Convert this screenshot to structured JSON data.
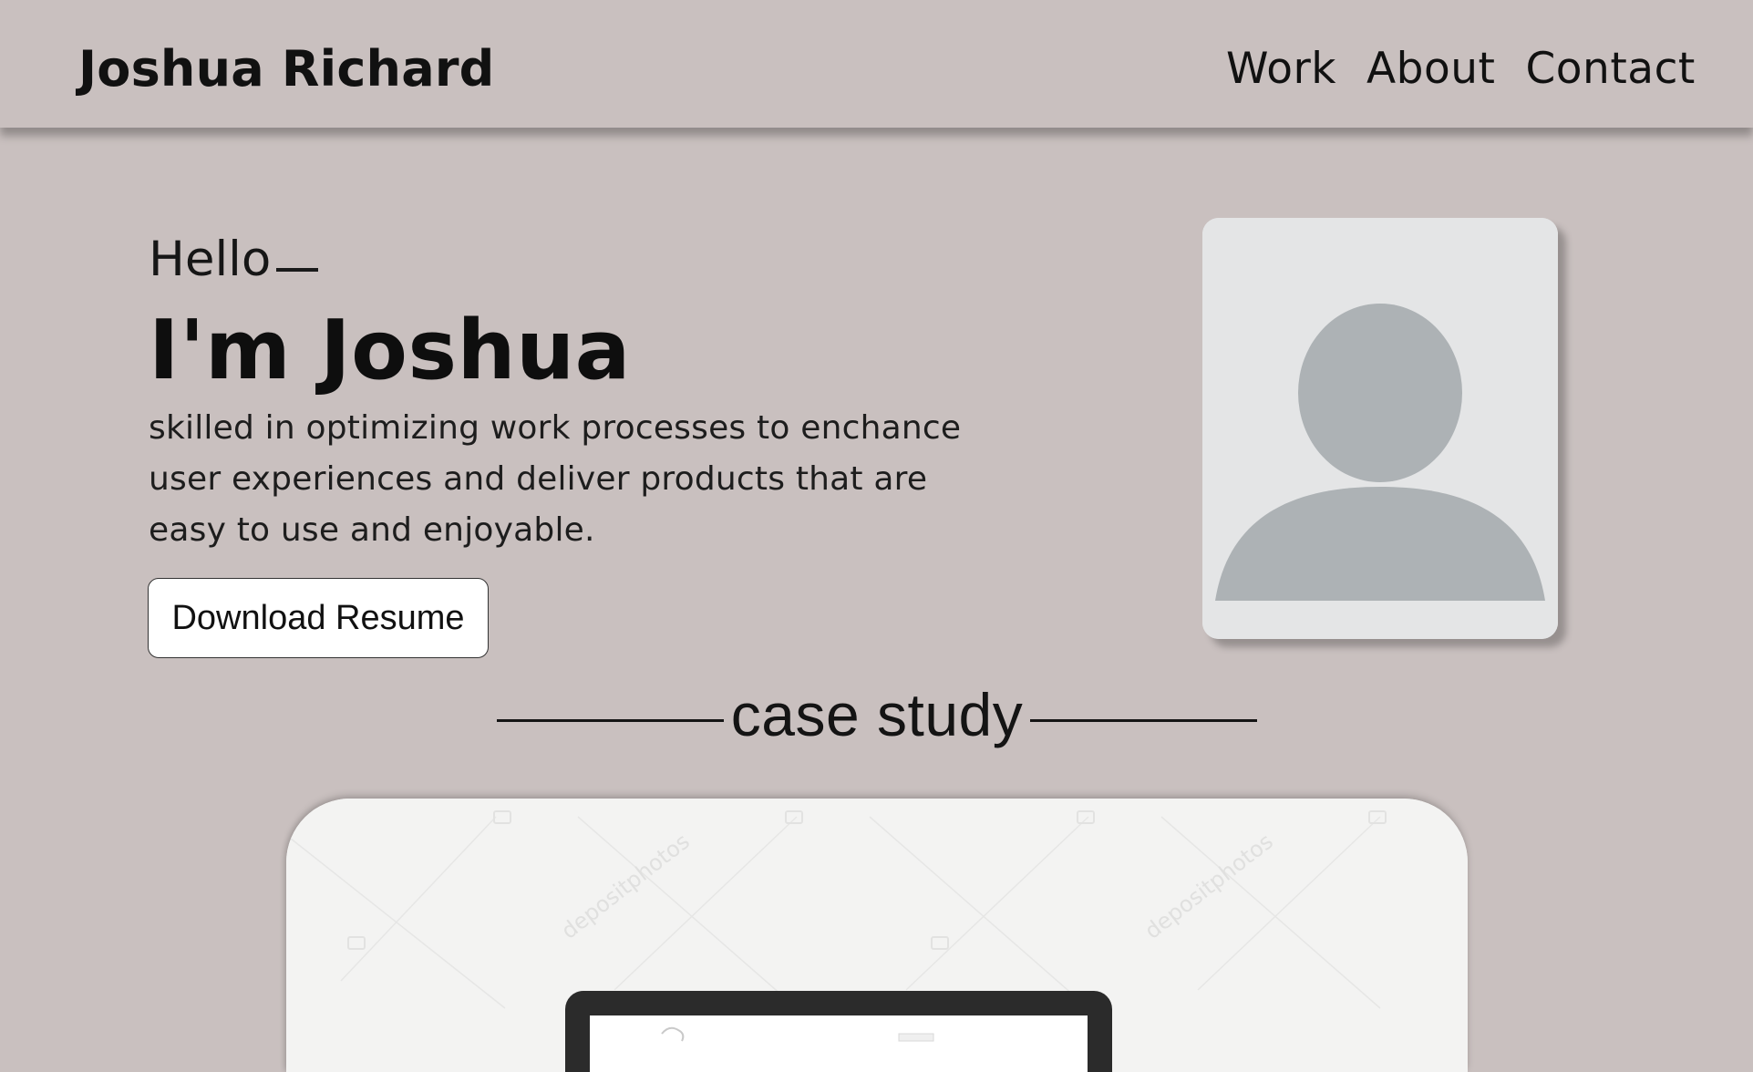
{
  "header": {
    "brand": "Joshua Richard",
    "nav": [
      {
        "label": "Work"
      },
      {
        "label": "About"
      },
      {
        "label": "Contact"
      }
    ]
  },
  "hero": {
    "greeting": "Hello",
    "name": "I'm Joshua",
    "description": "skilled in optimizing work processes to enchance user experiences and deliver products that are easy to use and enjoyable.",
    "resume_button": "Download Resume",
    "avatar_icon": "person-placeholder-icon"
  },
  "case_study": {
    "heading": "case study",
    "preview_watermark": "depositphotos",
    "preview_icon": "laptop-mockup-icon"
  },
  "colors": {
    "background": "#c9c0bf",
    "text": "#111111",
    "avatar_bg": "#e4e5e6",
    "avatar_silhouette": "#adb2b5",
    "card_bg": "#f3f3f2",
    "button_bg": "#ffffff"
  }
}
